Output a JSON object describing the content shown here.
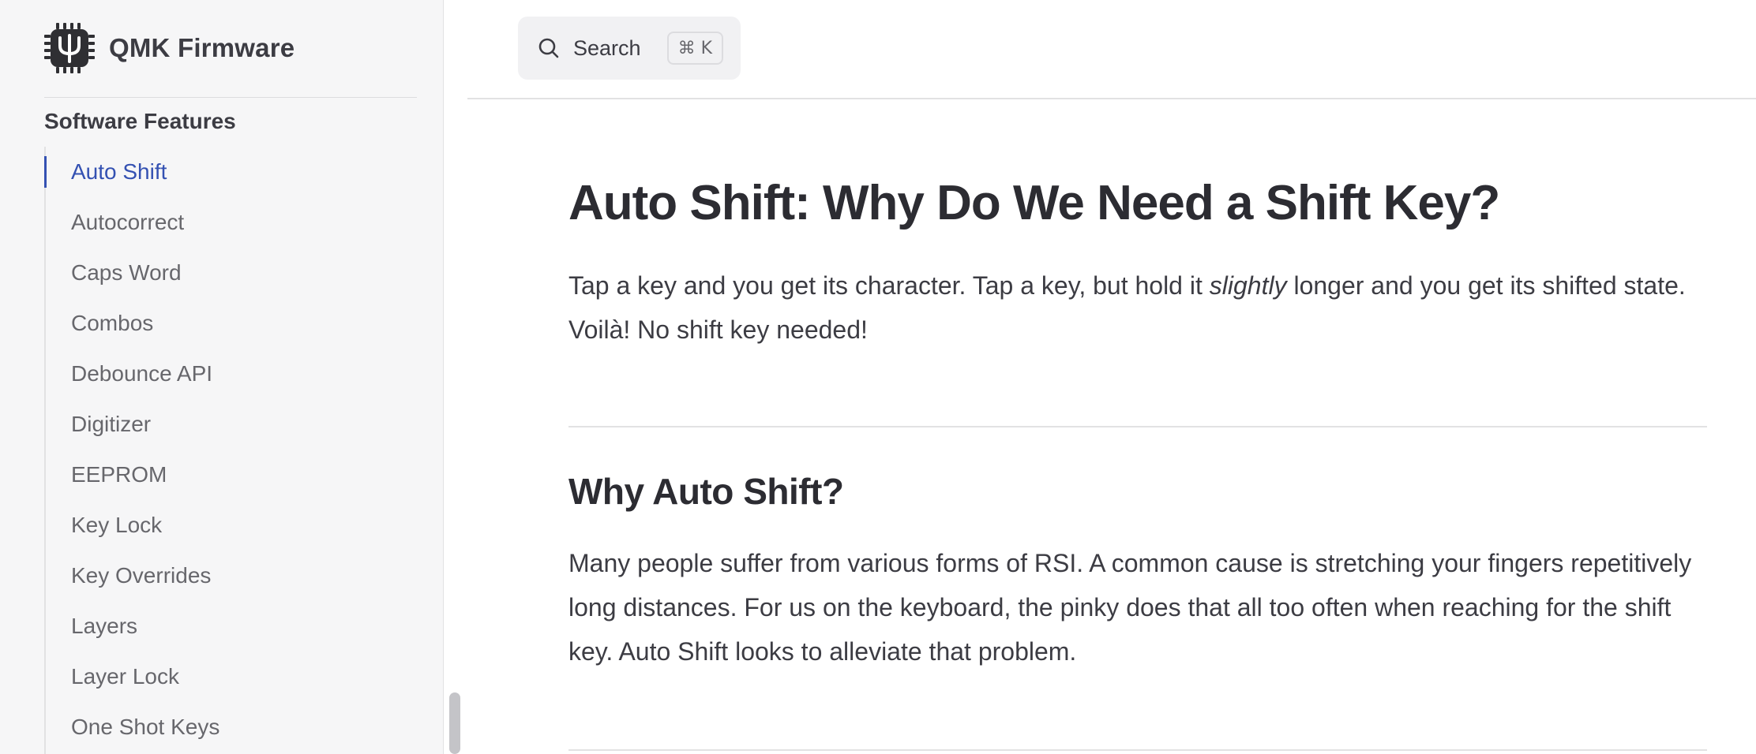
{
  "brand": {
    "title": "QMK Firmware",
    "logo_icon": "qmk-chip-psi-icon"
  },
  "sidebar": {
    "section_title": "Software Features",
    "items": [
      {
        "label": "Auto Shift",
        "active": true
      },
      {
        "label": "Autocorrect",
        "active": false
      },
      {
        "label": "Caps Word",
        "active": false
      },
      {
        "label": "Combos",
        "active": false
      },
      {
        "label": "Debounce API",
        "active": false
      },
      {
        "label": "Digitizer",
        "active": false
      },
      {
        "label": "EEPROM",
        "active": false
      },
      {
        "label": "Key Lock",
        "active": false
      },
      {
        "label": "Key Overrides",
        "active": false
      },
      {
        "label": "Layers",
        "active": false
      },
      {
        "label": "Layer Lock",
        "active": false
      },
      {
        "label": "One Shot Keys",
        "active": false
      }
    ]
  },
  "search": {
    "label": "Search",
    "shortcut": "⌘ K",
    "icon": "search-icon"
  },
  "article": {
    "title": "Auto Shift: Why Do We Need a Shift Key?",
    "intro_before": "Tap a key and you get its character. Tap a key, but hold it ",
    "intro_emphasis": "slightly",
    "intro_after": " longer and you get its shifted state. Voilà! No shift key needed!",
    "section_heading": "Why Auto Shift?",
    "section_body": "Many people suffer from various forms of RSI. A common cause is stretching your fingers repetitively long distances. For us on the keyboard, the pinky does that all too often when reaching for the shift key. Auto Shift looks to alleviate that problem."
  },
  "colors": {
    "accent": "#3451b2",
    "text": "#3c3c43",
    "sidebar_bg": "#f6f6f7"
  }
}
